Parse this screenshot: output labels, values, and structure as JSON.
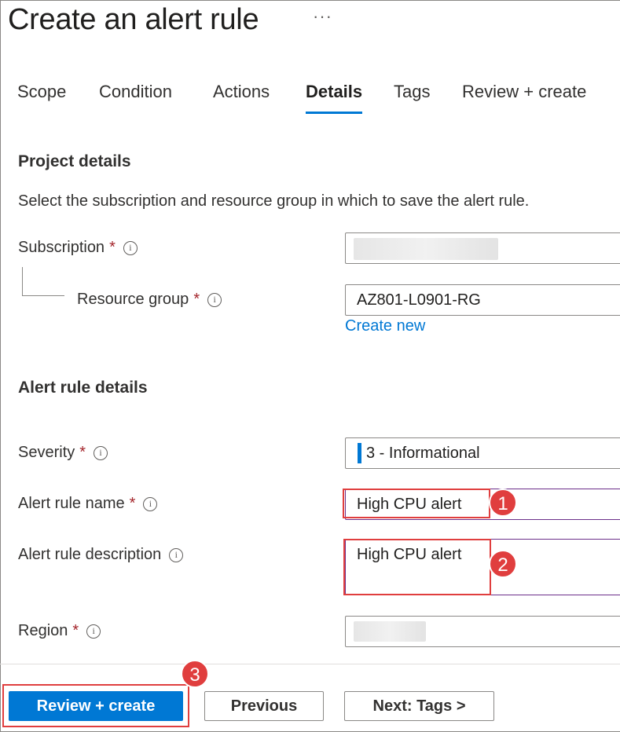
{
  "title": "Create an alert rule",
  "more_glyph": "···",
  "tabs": [
    {
      "label": "Scope"
    },
    {
      "label": "Condition"
    },
    {
      "label": "Actions"
    },
    {
      "label": "Details"
    },
    {
      "label": "Tags"
    },
    {
      "label": "Review + create"
    }
  ],
  "active_tab": "Details",
  "project": {
    "heading": "Project details",
    "description": "Select the subscription and resource group in which to save the alert rule.",
    "subscription_label": "Subscription",
    "resource_group_label": "Resource group",
    "resource_group_value": "AZ801-L0901-RG",
    "create_new_link": "Create new"
  },
  "alert": {
    "heading": "Alert rule details",
    "severity_label": "Severity",
    "severity_value": "3 - Informational",
    "name_label": "Alert rule name",
    "name_value": "High CPU alert",
    "description_label": "Alert rule description",
    "description_value": "High CPU alert",
    "region_label": "Region"
  },
  "required_mark": "*",
  "info_glyph": "i",
  "callouts": [
    "1",
    "2",
    "3"
  ],
  "buttons": {
    "review_create": "Review + create",
    "previous": "Previous",
    "next": "Next: Tags >"
  },
  "colors": {
    "accent": "#0078d4",
    "highlight": "#e03e3e",
    "required": "#a4262c"
  }
}
